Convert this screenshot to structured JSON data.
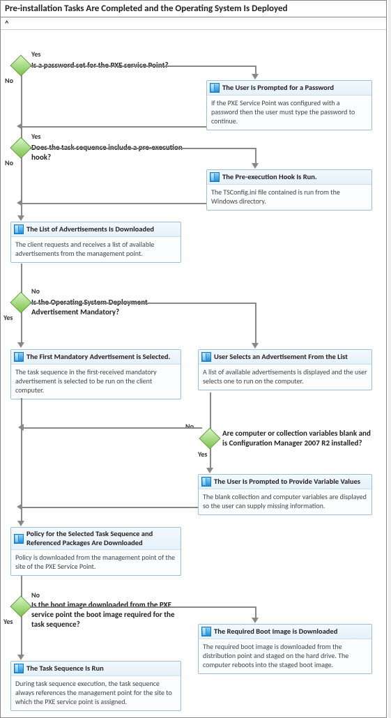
{
  "header": {
    "title": "Pre-installation Tasks Are Completed and the Operating System Is Deployed",
    "collapse_glyph": "^"
  },
  "labels": {
    "yes": "Yes",
    "no": "No"
  },
  "decisions": {
    "d1": "Is a password set for the PXE service Point?",
    "d2": "Does the task sequence include a pre-execution hook?",
    "d3": "Is the Operating System Deployment Advertisement Mandatory?",
    "d4": "Are computer or collection variables blank and is Configuration Manager 2007 R2 installed?",
    "d5": "Is the boot image downloaded from the PXE service point the boot image required for the task sequence?"
  },
  "processes": {
    "p1": {
      "title": "The User Is Prompted for a Password",
      "body": "If the PXE Service Point was configured with a password then the user must type the password to continue."
    },
    "p2": {
      "title": "The Pre-execution Hook Is Run.",
      "body": "The  TSConfig.ini file contained is run from the Windows directory."
    },
    "p3": {
      "title": "The List of Advertisements Is Downloaded",
      "body": "The client requests and receives a list of available advertisements from the management point."
    },
    "p4": {
      "title": "The First Mandatory Advertisement is Selected.",
      "body": "The task sequence in the first-received mandatory advertisement is selected to be run on the client computer."
    },
    "p5": {
      "title": "User Selects an Advertisement From the List",
      "body": "A list of available advertisements is displayed and the user selects one to run on the computer."
    },
    "p6": {
      "title": "The User Is Prompted to Provide Variable Values",
      "body": "The blank collection and computer variables are displayed so the user can supply missing information."
    },
    "p7": {
      "title": "Policy for the Selected Task Sequence and Referenced Packages Are Downloaded",
      "body": "Policy is downloaded from the management point of the site of the PXE Service Point."
    },
    "p8": {
      "title": "The Required Boot Image is Downloaded",
      "body": "The required boot image is downloaded from the distribution point and staged on the hard drive. The computer reboots into the staged boot image."
    },
    "p9": {
      "title": "The Task Sequence Is Run",
      "body": "During task sequence execution, the task sequence always references the management point for the site to which the PXE service point is assigned."
    }
  }
}
